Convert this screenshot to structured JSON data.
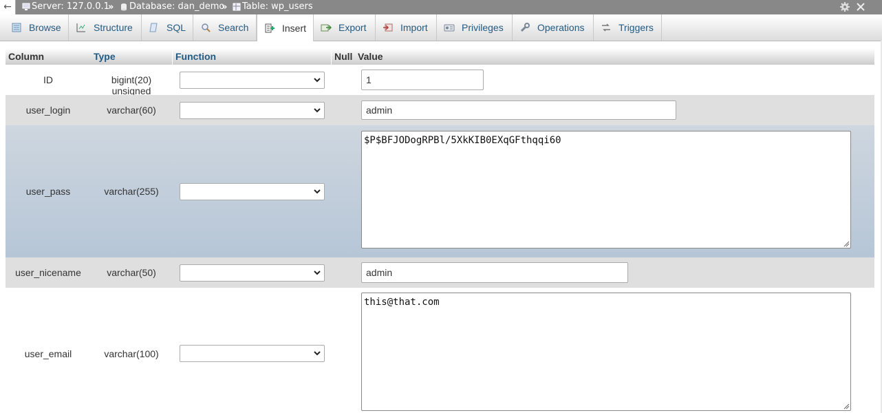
{
  "breadcrumb": {
    "back_glyph": "←",
    "server": "Server: 127.0.0.1",
    "database": "Database: dan_demo",
    "table": "Table: wp_users",
    "separator": "»",
    "tools_icons": [
      "gear-icon",
      "close-icon"
    ]
  },
  "tabs": [
    {
      "label": "Browse",
      "icon": "browse-icon"
    },
    {
      "label": "Structure",
      "icon": "structure-icon"
    },
    {
      "label": "SQL",
      "icon": "sql-icon"
    },
    {
      "label": "Search",
      "icon": "search-icon"
    },
    {
      "label": "Insert",
      "icon": "insert-icon",
      "active": true
    },
    {
      "label": "Export",
      "icon": "export-icon"
    },
    {
      "label": "Import",
      "icon": "import-icon"
    },
    {
      "label": "Privileges",
      "icon": "privileges-icon"
    },
    {
      "label": "Operations",
      "icon": "operations-icon"
    },
    {
      "label": "Triggers",
      "icon": "triggers-icon"
    }
  ],
  "headers": {
    "column": "Column",
    "type": "Type",
    "function": "Function",
    "null": "Null",
    "value": "Value"
  },
  "rows": [
    {
      "column": "ID",
      "type": "bigint(20) unsigned",
      "function": "",
      "value": "1"
    },
    {
      "column": "user_login",
      "type": "varchar(60)",
      "function": "",
      "value": "admin"
    },
    {
      "column": "user_pass",
      "type": "varchar(255)",
      "function": "",
      "value": "$P$BFJODogRPBl/5XkKIB0EXqGFthqqi60"
    },
    {
      "column": "user_nicename",
      "type": "varchar(50)",
      "function": "",
      "value": "admin"
    },
    {
      "column": "user_email",
      "type": "varchar(100)",
      "function": "",
      "value": "this@that.com"
    }
  ],
  "colors": {
    "link": "#235a81",
    "breadcrumb_bg": "#888888",
    "row_even": "#dfdfdf",
    "row_selected": "#c2cedb"
  }
}
